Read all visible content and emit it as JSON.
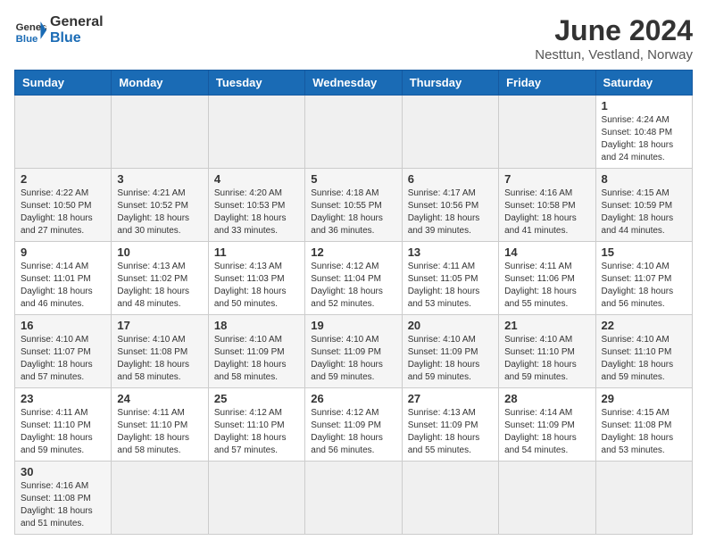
{
  "header": {
    "logo_general": "General",
    "logo_blue": "Blue",
    "month_title": "June 2024",
    "subtitle": "Nesttun, Vestland, Norway"
  },
  "weekdays": [
    "Sunday",
    "Monday",
    "Tuesday",
    "Wednesday",
    "Thursday",
    "Friday",
    "Saturday"
  ],
  "weeks": [
    [
      {
        "day": "",
        "info": ""
      },
      {
        "day": "",
        "info": ""
      },
      {
        "day": "",
        "info": ""
      },
      {
        "day": "",
        "info": ""
      },
      {
        "day": "",
        "info": ""
      },
      {
        "day": "",
        "info": ""
      },
      {
        "day": "1",
        "info": "Sunrise: 4:24 AM\nSunset: 10:48 PM\nDaylight: 18 hours\nand 24 minutes."
      }
    ],
    [
      {
        "day": "2",
        "info": "Sunrise: 4:22 AM\nSunset: 10:50 PM\nDaylight: 18 hours\nand 27 minutes."
      },
      {
        "day": "3",
        "info": "Sunrise: 4:21 AM\nSunset: 10:52 PM\nDaylight: 18 hours\nand 30 minutes."
      },
      {
        "day": "4",
        "info": "Sunrise: 4:20 AM\nSunset: 10:53 PM\nDaylight: 18 hours\nand 33 minutes."
      },
      {
        "day": "5",
        "info": "Sunrise: 4:18 AM\nSunset: 10:55 PM\nDaylight: 18 hours\nand 36 minutes."
      },
      {
        "day": "6",
        "info": "Sunrise: 4:17 AM\nSunset: 10:56 PM\nDaylight: 18 hours\nand 39 minutes."
      },
      {
        "day": "7",
        "info": "Sunrise: 4:16 AM\nSunset: 10:58 PM\nDaylight: 18 hours\nand 41 minutes."
      },
      {
        "day": "8",
        "info": "Sunrise: 4:15 AM\nSunset: 10:59 PM\nDaylight: 18 hours\nand 44 minutes."
      }
    ],
    [
      {
        "day": "9",
        "info": "Sunrise: 4:14 AM\nSunset: 11:01 PM\nDaylight: 18 hours\nand 46 minutes."
      },
      {
        "day": "10",
        "info": "Sunrise: 4:13 AM\nSunset: 11:02 PM\nDaylight: 18 hours\nand 48 minutes."
      },
      {
        "day": "11",
        "info": "Sunrise: 4:13 AM\nSunset: 11:03 PM\nDaylight: 18 hours\nand 50 minutes."
      },
      {
        "day": "12",
        "info": "Sunrise: 4:12 AM\nSunset: 11:04 PM\nDaylight: 18 hours\nand 52 minutes."
      },
      {
        "day": "13",
        "info": "Sunrise: 4:11 AM\nSunset: 11:05 PM\nDaylight: 18 hours\nand 53 minutes."
      },
      {
        "day": "14",
        "info": "Sunrise: 4:11 AM\nSunset: 11:06 PM\nDaylight: 18 hours\nand 55 minutes."
      },
      {
        "day": "15",
        "info": "Sunrise: 4:10 AM\nSunset: 11:07 PM\nDaylight: 18 hours\nand 56 minutes."
      }
    ],
    [
      {
        "day": "16",
        "info": "Sunrise: 4:10 AM\nSunset: 11:07 PM\nDaylight: 18 hours\nand 57 minutes."
      },
      {
        "day": "17",
        "info": "Sunrise: 4:10 AM\nSunset: 11:08 PM\nDaylight: 18 hours\nand 58 minutes."
      },
      {
        "day": "18",
        "info": "Sunrise: 4:10 AM\nSunset: 11:09 PM\nDaylight: 18 hours\nand 58 minutes."
      },
      {
        "day": "19",
        "info": "Sunrise: 4:10 AM\nSunset: 11:09 PM\nDaylight: 18 hours\nand 59 minutes."
      },
      {
        "day": "20",
        "info": "Sunrise: 4:10 AM\nSunset: 11:09 PM\nDaylight: 18 hours\nand 59 minutes."
      },
      {
        "day": "21",
        "info": "Sunrise: 4:10 AM\nSunset: 11:10 PM\nDaylight: 18 hours\nand 59 minutes."
      },
      {
        "day": "22",
        "info": "Sunrise: 4:10 AM\nSunset: 11:10 PM\nDaylight: 18 hours\nand 59 minutes."
      }
    ],
    [
      {
        "day": "23",
        "info": "Sunrise: 4:11 AM\nSunset: 11:10 PM\nDaylight: 18 hours\nand 59 minutes."
      },
      {
        "day": "24",
        "info": "Sunrise: 4:11 AM\nSunset: 11:10 PM\nDaylight: 18 hours\nand 58 minutes."
      },
      {
        "day": "25",
        "info": "Sunrise: 4:12 AM\nSunset: 11:10 PM\nDaylight: 18 hours\nand 57 minutes."
      },
      {
        "day": "26",
        "info": "Sunrise: 4:12 AM\nSunset: 11:09 PM\nDaylight: 18 hours\nand 56 minutes."
      },
      {
        "day": "27",
        "info": "Sunrise: 4:13 AM\nSunset: 11:09 PM\nDaylight: 18 hours\nand 55 minutes."
      },
      {
        "day": "28",
        "info": "Sunrise: 4:14 AM\nSunset: 11:09 PM\nDaylight: 18 hours\nand 54 minutes."
      },
      {
        "day": "29",
        "info": "Sunrise: 4:15 AM\nSunset: 11:08 PM\nDaylight: 18 hours\nand 53 minutes."
      }
    ],
    [
      {
        "day": "30",
        "info": "Sunrise: 4:16 AM\nSunset: 11:08 PM\nDaylight: 18 hours\nand 51 minutes."
      },
      {
        "day": "",
        "info": ""
      },
      {
        "day": "",
        "info": ""
      },
      {
        "day": "",
        "info": ""
      },
      {
        "day": "",
        "info": ""
      },
      {
        "day": "",
        "info": ""
      },
      {
        "day": "",
        "info": ""
      }
    ]
  ]
}
